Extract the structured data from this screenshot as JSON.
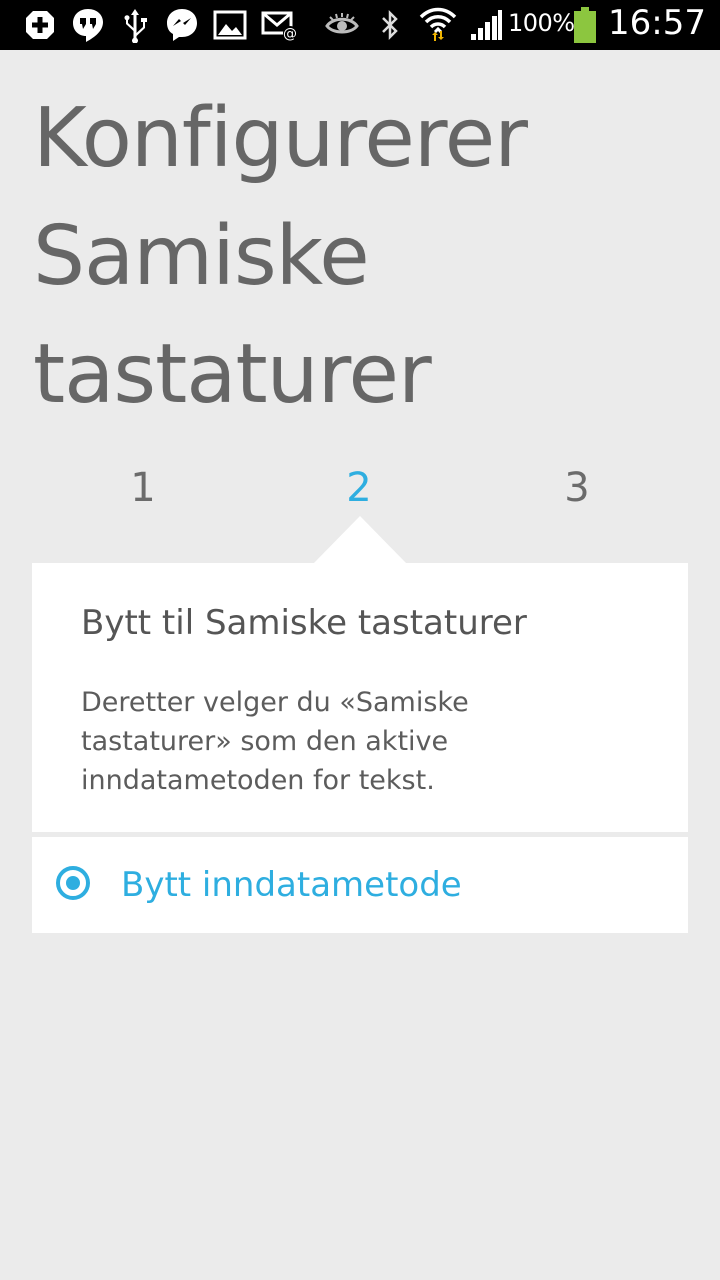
{
  "status_bar": {
    "icons": [
      "add-icon",
      "hangouts-icon",
      "usb-icon",
      "messenger-icon",
      "gallery-icon",
      "email-icon",
      "eye-icon",
      "bluetooth-icon",
      "wifi-icon",
      "signal-icon",
      "battery-icon"
    ],
    "battery_percent": "100%",
    "time": "16:57",
    "colors": {
      "background": "#000000",
      "foreground": "#ffffff",
      "battery": "#8cc63f",
      "wifi_arrows": "#f0b400"
    }
  },
  "page": {
    "title": "Konfigurerer\nSamiske\ntastaturer",
    "steps": [
      "1",
      "2",
      "3"
    ],
    "active_step": 2
  },
  "card": {
    "title": "Bytt til Samiske tastaturer",
    "description": "Deretter velger du  «Samiske\ntastaturer» som den aktive\ninndatametoden for tekst."
  },
  "action": {
    "label": "Bytt inndatametode",
    "selected": true
  },
  "colors": {
    "accent": "#2eaee0",
    "background": "#ebebeb",
    "title_text": "#666666",
    "card": "#ffffff"
  }
}
